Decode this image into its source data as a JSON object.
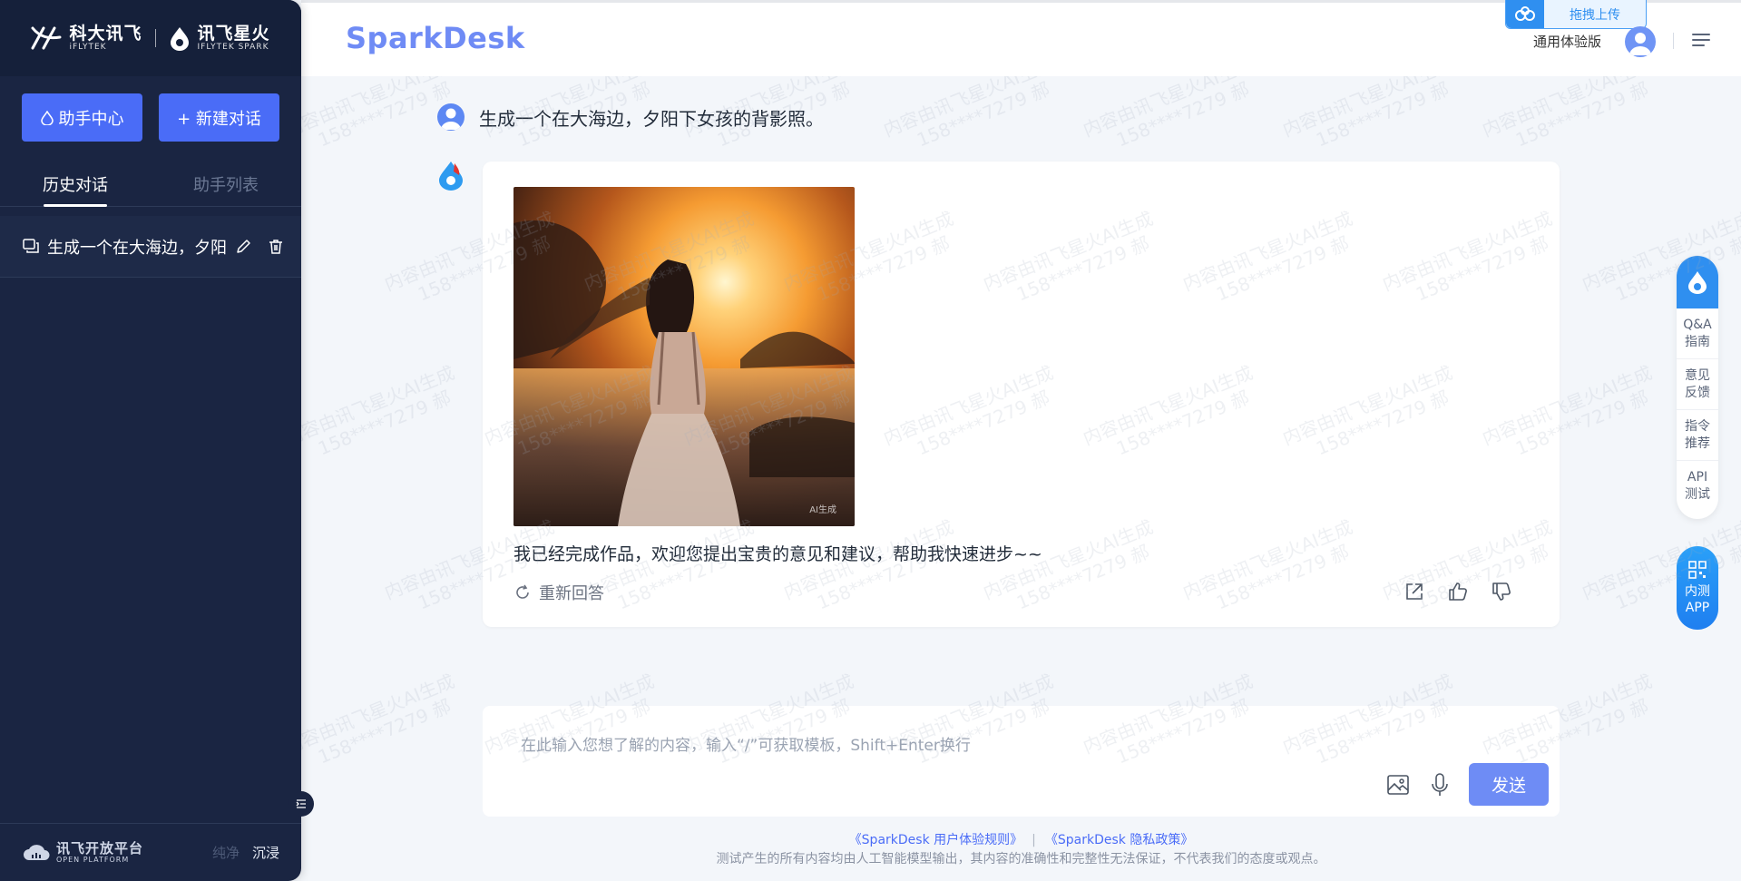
{
  "sidebar": {
    "logos": [
      {
        "name": "科大讯飞",
        "sub": "iFLYTEK"
      },
      {
        "name": "讯飞星火",
        "sub": "IFLYTEK SPARK"
      }
    ],
    "help_center_label": "助手中心",
    "new_chat_label": "+ 新建对话",
    "tabs": [
      {
        "label": "历史对话",
        "active": true
      },
      {
        "label": "助手列表",
        "active": false
      }
    ],
    "history": [
      {
        "title": "生成一个在大海边，夕阳"
      }
    ],
    "footer": {
      "platform_name": "讯飞开放平台",
      "platform_sub": "OPEN PLATFORM",
      "mode_pure": "纯净",
      "mode_immersive": "沉浸"
    }
  },
  "header": {
    "brand": "SparkDesk",
    "drag_upload_label": "拖拽上传",
    "edition": "通用体验版"
  },
  "chat": {
    "user_message": "生成一个在大海边，夕阳下女孩的背影照。",
    "image_tag": "AI生成",
    "answer_text": "我已经完成作品，欢迎您提出宝贵的意见和建议，帮助我快速进步~~",
    "regenerate_label": "重新回答"
  },
  "input": {
    "placeholder": "在此输入您想了解的内容，输入“/”可获取模板，Shift+Enter换行",
    "send_label": "发送"
  },
  "footer": {
    "link_rules": "《SparkDesk 用户体验规则》",
    "link_privacy": "《SparkDesk 隐私政策》",
    "separator": "|",
    "disclaimer": "测试产生的所有内容均由人工智能模型输出，其内容的准确性和完整性无法保证，不代表我们的态度或观点。"
  },
  "right_rail": {
    "items": [
      "Q&A\n指南",
      "意见\n反馈",
      "指令\n推荐",
      "API\n测试"
    ],
    "app_label_1": "内测",
    "app_label_2": "APP"
  },
  "watermark": {
    "line1": "内容由讯飞星火AI生成",
    "line2": "158****7279 郝"
  },
  "colors": {
    "sidebar_bg": "#1a2542",
    "accent": "#4a6cf7",
    "send": "#6e8cf5",
    "brand": "#6f8bf5",
    "rail_blue": "#2f8ff0"
  }
}
